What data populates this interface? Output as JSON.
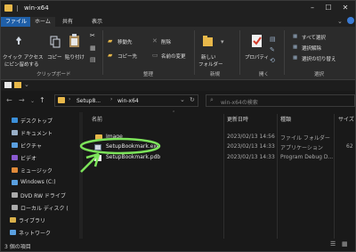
{
  "window": {
    "title": "win-x64"
  },
  "ribbon_tabs": [
    "ファイル",
    "ホーム",
    "共有",
    "表示"
  ],
  "ribbon": {
    "clipboard": {
      "pin_label_1": "クイック アクセス",
      "pin_label_2": "にピン留めする",
      "copy": "コピー",
      "paste": "貼り付け",
      "cut_icon": "scissors-icon",
      "group": "クリップボード"
    },
    "organize": {
      "move": "移動先",
      "copy_to": "コピー先",
      "delete": "削除",
      "rename": "名前の変更",
      "group": "整理"
    },
    "new": {
      "new_folder_1": "新しい",
      "new_folder_2": "フォルダー",
      "group": "新規"
    },
    "open": {
      "properties": "プロパティ",
      "group": "開く"
    },
    "select": {
      "select_all": "すべて選択",
      "select_none": "選択解除",
      "invert": "選択の切り替え",
      "group": "選択"
    }
  },
  "address": {
    "crumbs": [
      "Setup8...",
      "win-x64"
    ],
    "search_placeholder": "win-x64の検索"
  },
  "nav_pane": [
    {
      "label": "デスクトップ",
      "color": "#3b8fd9"
    },
    {
      "label": "ドキュメント",
      "color": "#9ab0c8"
    },
    {
      "label": "ピクチャ",
      "color": "#5aa0e0"
    },
    {
      "label": "ビデオ",
      "color": "#8a5ad0"
    },
    {
      "label": "ミュージック",
      "color": "#e08a3a"
    },
    {
      "label": "Windows (C:)",
      "color": "#5aa0e0"
    },
    {
      "label": "DVD RW ドライブ",
      "color": "#aaaaaa"
    },
    {
      "label": "ローカル ディスク (",
      "color": "#aaaaaa"
    },
    {
      "label": "ライブラリ",
      "color": "#d9b04a"
    },
    {
      "label": "ネットワーク",
      "color": "#5aa0e0"
    }
  ],
  "columns": [
    "名前",
    "更新日時",
    "種類",
    "サイズ"
  ],
  "files": [
    {
      "name": "Image",
      "modified": "2023/02/13 14:56",
      "type": "ファイル フォルダー",
      "size": "",
      "icon": "folder-icon"
    },
    {
      "name": "SetupBookmark.exe",
      "modified": "2023/02/13 14:33",
      "type": "アプリケーション",
      "size": "62",
      "icon": "exe-icon"
    },
    {
      "name": "SetupBookmark.pdb",
      "modified": "2023/02/13 14:33",
      "type": "Program Debug D...",
      "size": "",
      "icon": "pdb-icon"
    }
  ],
  "status": {
    "item_count": "3 個の項目"
  },
  "colors": {
    "accent": "#1f5fa8",
    "highlight": "#7ce35a",
    "folder": "#e8b84a"
  }
}
